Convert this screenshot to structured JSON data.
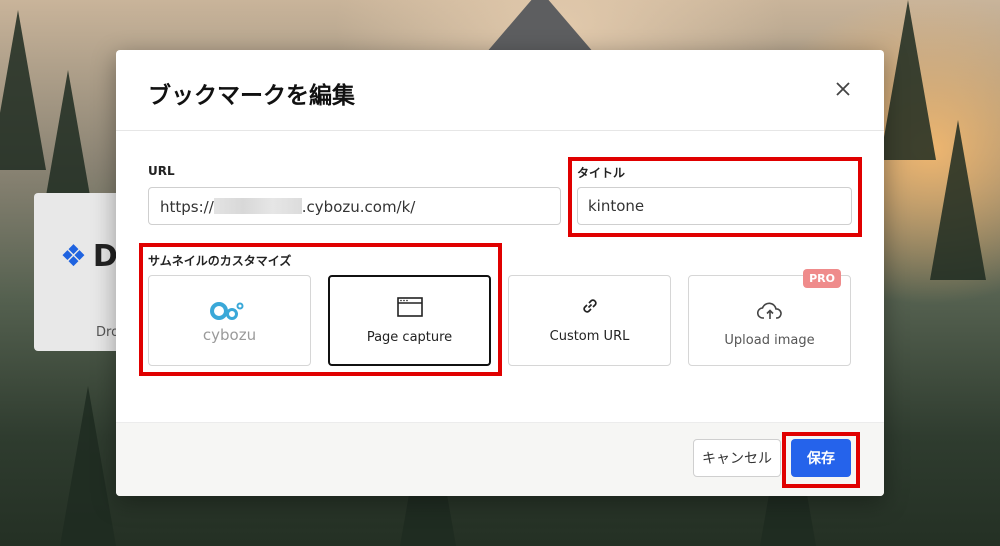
{
  "background_card": {
    "logo_text": "D",
    "label": "Dro"
  },
  "dialog": {
    "title": "ブックマークを編集",
    "url_label": "URL",
    "url_prefix": "https://",
    "url_suffix": ".cybozu.com/k/",
    "title_label": "タイトル",
    "title_value": "kintone",
    "thumbnail_label": "サムネイルのカスタマイズ",
    "thumbnail_options": [
      {
        "label": "cybozu",
        "icon": "cybozu-logo"
      },
      {
        "label": "Page capture",
        "icon": "browser-window-icon",
        "selected": true
      },
      {
        "label": "Custom URL",
        "icon": "link-icon"
      },
      {
        "label": "Upload image",
        "icon": "cloud-upload-icon",
        "badge": "PRO"
      }
    ],
    "cancel_label": "キャンセル",
    "save_label": "保存"
  },
  "colors": {
    "primary": "#2563eb",
    "pro_badge": "#ef8b8b",
    "annotation": "#e00000",
    "cybozu_blue": "#3aa8d8"
  }
}
